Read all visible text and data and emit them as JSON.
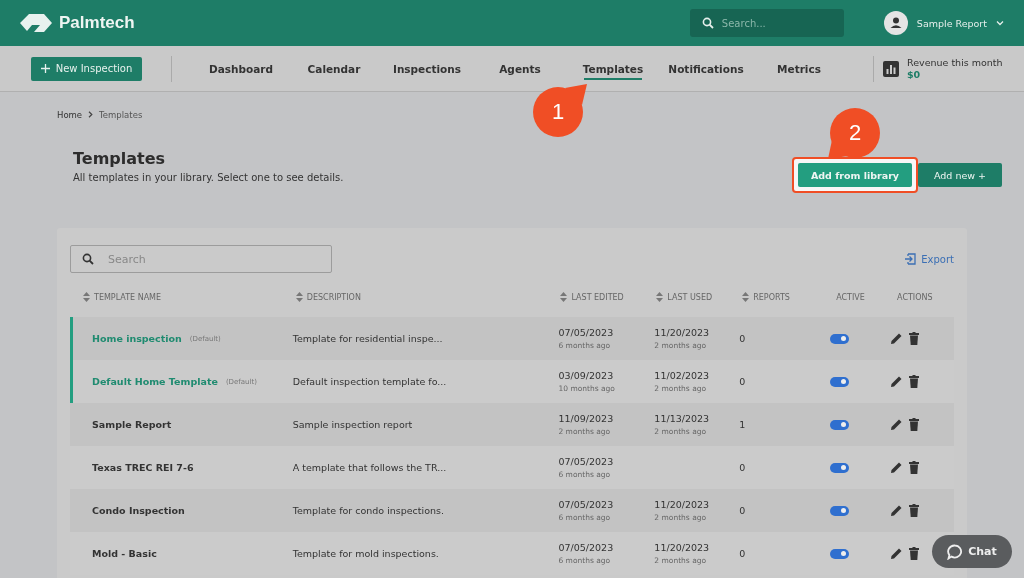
{
  "header": {
    "brand": "Palmtech",
    "search": {
      "placeholder": "Search..."
    },
    "user": "Sample Report"
  },
  "nav": {
    "new_button": "New Inspection",
    "tabs": [
      {
        "label": "Dashboard",
        "selected": false
      },
      {
        "label": "Calendar",
        "selected": false
      },
      {
        "label": "Inspections",
        "selected": false
      },
      {
        "label": "Agents",
        "selected": false
      },
      {
        "label": "Templates",
        "selected": true
      },
      {
        "label": "Notifications",
        "selected": false
      },
      {
        "label": "Metrics",
        "selected": false
      }
    ],
    "revenue": {
      "label": "Revenue this month",
      "value": "$0"
    }
  },
  "breadcrumb": [
    "Home",
    "Templates"
  ],
  "page": {
    "title": "Templates",
    "subtitle": "All templates in your library. Select one to see details.",
    "buttons": [
      {
        "label": "Add from library",
        "kind": "primary",
        "highlighted": true
      },
      {
        "label": "Add new  +",
        "kind": "secondary",
        "highlighted": false
      }
    ]
  },
  "table": {
    "search": {
      "placeholder": "Search"
    },
    "export": "Export",
    "columns": [
      {
        "label": "TEMPLATE NAME",
        "sortable": true
      },
      {
        "label": "DESCRIPTION",
        "sortable": true
      },
      {
        "label": "LAST EDITED",
        "sortable": true
      },
      {
        "label": "LAST USED",
        "sortable": true
      },
      {
        "label": "REPORTS",
        "sortable": true
      },
      {
        "label": "ACTIVE",
        "sortable": false
      },
      {
        "label": "ACTIONS",
        "sortable": false
      }
    ],
    "rows": [
      {
        "name": "Home inspection",
        "is_default": true,
        "default_label": "(Default)",
        "description": "Template for residential inspe...",
        "last_edited": "07/05/2023",
        "last_edited_ago": "6 months ago",
        "last_used": "11/20/2023",
        "last_used_ago": "2 months ago",
        "reports": "0",
        "active": true
      },
      {
        "name": "Default Home Template",
        "is_default": true,
        "default_label": "(Default)",
        "description": "Default inspection template fo...",
        "last_edited": "03/09/2023",
        "last_edited_ago": "10 months ago",
        "last_used": "11/02/2023",
        "last_used_ago": "2 months ago",
        "reports": "0",
        "active": true
      },
      {
        "name": "Sample Report",
        "is_default": false,
        "description": "Sample inspection report",
        "last_edited": "11/09/2023",
        "last_edited_ago": "2 months ago",
        "last_used": "11/13/2023",
        "last_used_ago": "2 months ago",
        "reports": "1",
        "active": true
      },
      {
        "name": "Texas TREC REI 7-6",
        "is_default": false,
        "description": "A template that follows the TR...",
        "last_edited": "07/05/2023",
        "last_edited_ago": "6 months ago",
        "reports": "0",
        "active": true
      },
      {
        "name": "Condo Inspection",
        "is_default": false,
        "description": "Template for condo inspections.",
        "last_edited": "07/05/2023",
        "last_edited_ago": "6 months ago",
        "last_used": "11/20/2023",
        "last_used_ago": "2 months ago",
        "reports": "0",
        "active": true
      },
      {
        "name": "Mold - Basic",
        "is_default": false,
        "description": "Template for mold inspections.",
        "last_edited": "07/05/2023",
        "last_edited_ago": "6 months ago",
        "last_used": "11/20/2023",
        "last_used_ago": "2 months ago",
        "reports": "0",
        "active": true
      }
    ]
  },
  "callouts": [
    {
      "label": "1"
    },
    {
      "label": "2"
    }
  ],
  "chat": "Chat"
}
